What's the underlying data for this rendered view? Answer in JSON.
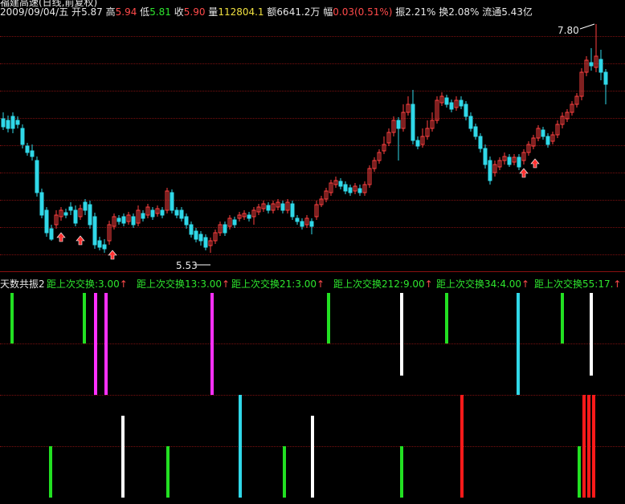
{
  "header": {
    "title": "福建高速(日线,前复权)",
    "date": "2009/09/04/五",
    "open_label": "开",
    "open": "5.87",
    "high_label": "高",
    "high": "5.94",
    "low_label": "低",
    "low": "5.81",
    "close_label": "收",
    "close": "5.90",
    "volume_label": "量",
    "volume": "112804.1",
    "amount_label": "额",
    "amount": "6641.2万",
    "change_label": "幅",
    "change": "0.03(0.51%)",
    "amplitude": "振2.21%",
    "turnover": "换2.08%",
    "float_cap": "流通5.43亿"
  },
  "price_chart": {
    "high_marker": "7.80",
    "low_marker": "5.53",
    "colors": {
      "up": "#ff4040",
      "down": "#30d8e8",
      "signal_arrow": "#ff3030"
    }
  },
  "indicator": {
    "name": "天数共振2",
    "labels": [
      "距上次交换:3.00",
      "距上次交换13:3.00",
      "距上次交换21:3.00",
      "距上次交换212:9.00",
      "距上次交换34:4.00",
      "距上次交换55:17."
    ],
    "arrow": "↑"
  },
  "chart_data": {
    "type": "candlestick",
    "title": "福建高速(日线,前复权)",
    "price_range": [
      5.53,
      7.8
    ],
    "candles_note": "daily candlesticks; red=up, cyan=down",
    "signal_bars_upper": [
      {
        "color": "green"
      },
      {
        "color": "green"
      },
      {
        "color": "magenta"
      },
      {
        "color": "magenta"
      },
      {
        "color": "magenta"
      },
      {
        "color": "green"
      },
      {
        "color": "white"
      },
      {
        "color": "green"
      },
      {
        "color": "cyan"
      },
      {
        "color": "green"
      },
      {
        "color": "white"
      }
    ],
    "signal_bars_lower": [
      {
        "color": "green"
      },
      {
        "color": "white"
      },
      {
        "color": "green"
      },
      {
        "color": "cyan"
      },
      {
        "color": "green"
      },
      {
        "color": "white"
      },
      {
        "color": "green"
      },
      {
        "color": "red"
      },
      {
        "color": "green"
      },
      {
        "color": "red"
      }
    ]
  }
}
